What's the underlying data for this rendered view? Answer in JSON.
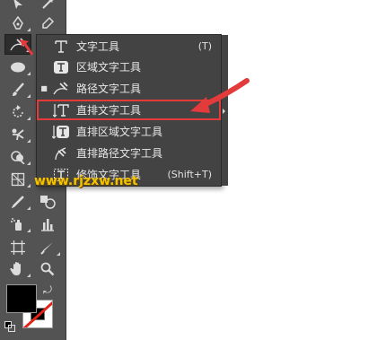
{
  "flyout": {
    "items": [
      {
        "label": "文字工具",
        "shortcut": "(T)",
        "icon": "type-tool-icon",
        "bullet": ""
      },
      {
        "label": "区域文字工具",
        "shortcut": "",
        "icon": "area-type-tool-icon",
        "bullet": ""
      },
      {
        "label": "路径文字工具",
        "shortcut": "",
        "icon": "type-on-path-tool-icon",
        "bullet": "■"
      },
      {
        "label": "直排文字工具",
        "shortcut": "",
        "icon": "vertical-type-tool-icon",
        "bullet": ""
      },
      {
        "label": "直排区域文字工具",
        "shortcut": "",
        "icon": "vertical-area-type-tool-icon",
        "bullet": ""
      },
      {
        "label": "直排路径文字工具",
        "shortcut": "",
        "icon": "vertical-type-on-path-tool-icon",
        "bullet": ""
      },
      {
        "label": "修饰文字工具",
        "shortcut": "(Shift+T)",
        "icon": "touch-type-tool-icon",
        "bullet": ""
      }
    ],
    "selected_index": 3
  },
  "watermark": "www.rjzxw.net",
  "colors": {
    "toolbar_bg": "#535353",
    "menu_bg": "#434343",
    "highlight_red": "#e33b3b",
    "watermark": "#f3c200"
  }
}
